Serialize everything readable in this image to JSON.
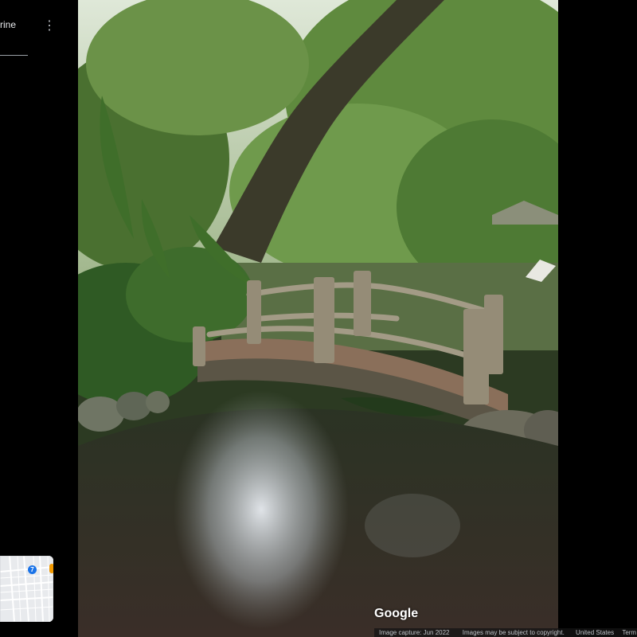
{
  "place": {
    "title": "rine"
  },
  "menu": {
    "more_icon": "⋮"
  },
  "minimap": {
    "pin_label": "7"
  },
  "viewer": {
    "logo": "Google"
  },
  "attribution": {
    "capture_date": "Image capture: Jun 2022",
    "copyright": "Images may be subject to copyright.",
    "country": "United States",
    "terms": "Term"
  },
  "colors": {
    "accent": "#1a73e8",
    "marker": "#f29900",
    "background": "#000000"
  }
}
